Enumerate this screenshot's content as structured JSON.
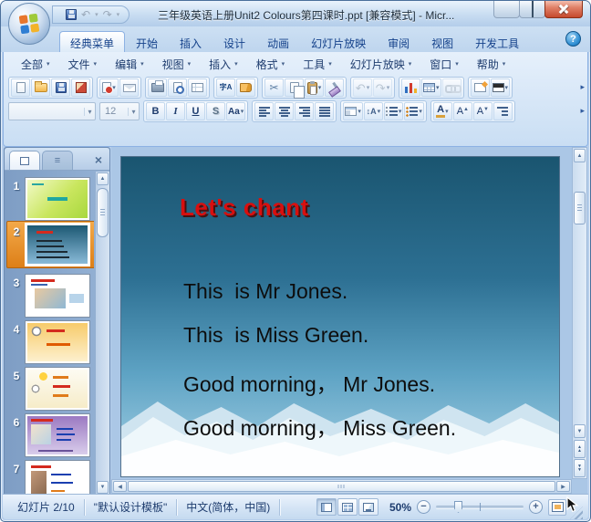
{
  "titlebar": {
    "title": "三年级英语上册Unit2 Colours第四课时.ppt [兼容模式] - Micr..."
  },
  "ribbon": {
    "tabs": [
      {
        "label": "经典菜单"
      },
      {
        "label": "开始"
      },
      {
        "label": "插入"
      },
      {
        "label": "设计"
      },
      {
        "label": "动画"
      },
      {
        "label": "幻灯片放映"
      },
      {
        "label": "审阅"
      },
      {
        "label": "视图"
      },
      {
        "label": "开发工具"
      }
    ]
  },
  "menubar": {
    "items": [
      "全部",
      "文件",
      "编辑",
      "视图",
      "插入",
      "格式",
      "工具",
      "幻灯片放映",
      "窗口",
      "帮助"
    ]
  },
  "toolbar": {
    "font_name_value": "",
    "font_size_value": "12",
    "bold_label": "B",
    "italic_label": "I",
    "underline_label": "U",
    "shadow_label": "S",
    "case_label": "Aa",
    "spell_label": "字A",
    "font_color_label": "A",
    "grow_font_label": "A",
    "shrink_font_label": "A"
  },
  "icons": {
    "caret": "▾",
    "undo": "↶",
    "redo": "↷",
    "cut": "✂",
    "help": "?",
    "overflow": "▸",
    "scroll_up": "▲",
    "scroll_down": "▼",
    "scroll_left": "◀",
    "scroll_right": "▶",
    "outline_tab": "≡",
    "close_pane": "×"
  },
  "sidebar": {
    "thumbnails": [
      {
        "number": "1"
      },
      {
        "number": "2"
      },
      {
        "number": "3"
      },
      {
        "number": "4"
      },
      {
        "number": "5"
      },
      {
        "number": "6"
      },
      {
        "number": "7"
      }
    ]
  },
  "slide": {
    "title": "Let's chant",
    "lines": [
      "This  is Mr Jones.",
      "This  is Miss Green.",
      "Good morning， Mr Jones.",
      "Good morning， Miss Green."
    ]
  },
  "statusbar": {
    "slide_indicator": "幻灯片 2/10",
    "design_template": "\"默认设计模板\"",
    "language": "中文(简体，中国)",
    "zoom_level": "50%"
  }
}
